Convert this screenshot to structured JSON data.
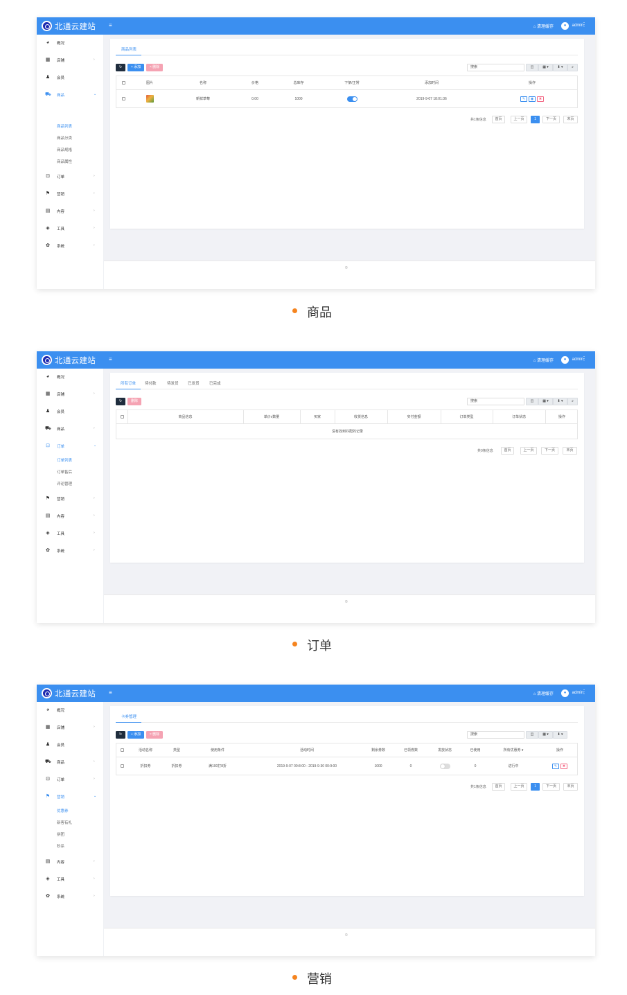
{
  "common": {
    "brand": "北通云建站",
    "menu_toggle": "≡",
    "clear_cache": "清理缓存",
    "user": "admin",
    "user_more": "⋮",
    "footer_mark": "©",
    "refresh_icon": "↻",
    "search_placeholder": "搜索",
    "tool_cols": "◫",
    "tool_grid": "▦ ▾",
    "tool_export": "⬇ ▾",
    "tool_search": "⌕",
    "page_first": "首页",
    "page_prev": "上一页",
    "page_next": "下一页",
    "page_last": "末页",
    "arrow_collapsed": "›",
    "arrow_expanded": "⌄",
    "nav": [
      {
        "label": "概况",
        "icon": "dashboard-icon"
      },
      {
        "label": "店铺",
        "icon": "grid-icon"
      },
      {
        "label": "会员",
        "icon": "users-icon"
      },
      {
        "label": "商品",
        "icon": "cart-icon"
      },
      {
        "label": "订单",
        "icon": "order-icon"
      },
      {
        "label": "营销",
        "icon": "flag-icon"
      },
      {
        "label": "内容",
        "icon": "file-icon"
      },
      {
        "label": "工具",
        "icon": "cube-icon"
      },
      {
        "label": "系统",
        "icon": "gear-icon"
      }
    ]
  },
  "products": {
    "caption": "商品",
    "tab": "商品列表",
    "add_label": "+ 添加",
    "del_label": "× 删除",
    "sub_items": [
      "商品列表",
      "商品分类",
      "商品规格",
      "商品属性"
    ],
    "columns": [
      "图片",
      "名称",
      "价格",
      "总库存",
      "下架/正常",
      "添加时间",
      "操作"
    ],
    "row": {
      "name": "新鲜草莓",
      "price": "0.00",
      "stock": "1000",
      "status_on": true,
      "added": "2019-9-07 18:01:36"
    },
    "pager_text": "共1条信息",
    "page": "1"
  },
  "orders": {
    "caption": "订单",
    "tabs": [
      "所有订单",
      "待付款",
      "待发货",
      "已发货",
      "已完成"
    ],
    "del_label": "删除",
    "sub_items": [
      "订单列表",
      "订单售后",
      "评论管理"
    ],
    "columns": [
      "商品信息",
      "单价x数量",
      "买家",
      "收货信息",
      "实付金额",
      "订单类型",
      "订单状态",
      "操作"
    ],
    "empty_text": "没有找到匹配的记录",
    "pager_text": "共0条信息"
  },
  "marketing": {
    "caption": "营销",
    "tab": "卡券管理",
    "add_label": "+ 添加",
    "del_label": "× 删除",
    "sub_items": [
      "优惠券",
      "新客有礼",
      "拼团",
      "秒杀"
    ],
    "columns": [
      "活动名称",
      "类型",
      "使用条件",
      "活动时间",
      "剩余券数",
      "已领券数",
      "发放状态",
      "已使用",
      "所有优惠券 ▾",
      "操作"
    ],
    "row": {
      "name": "折扣券",
      "type": "折扣券",
      "condition": "满100打8折",
      "time": "2019-9-07 00:8:00 - 2019-9-30 00:9:00",
      "left": "1000",
      "received": "0",
      "status_on": false,
      "used": "0",
      "state": "进行中"
    },
    "pager_text": "共1条信息",
    "page": "1"
  }
}
